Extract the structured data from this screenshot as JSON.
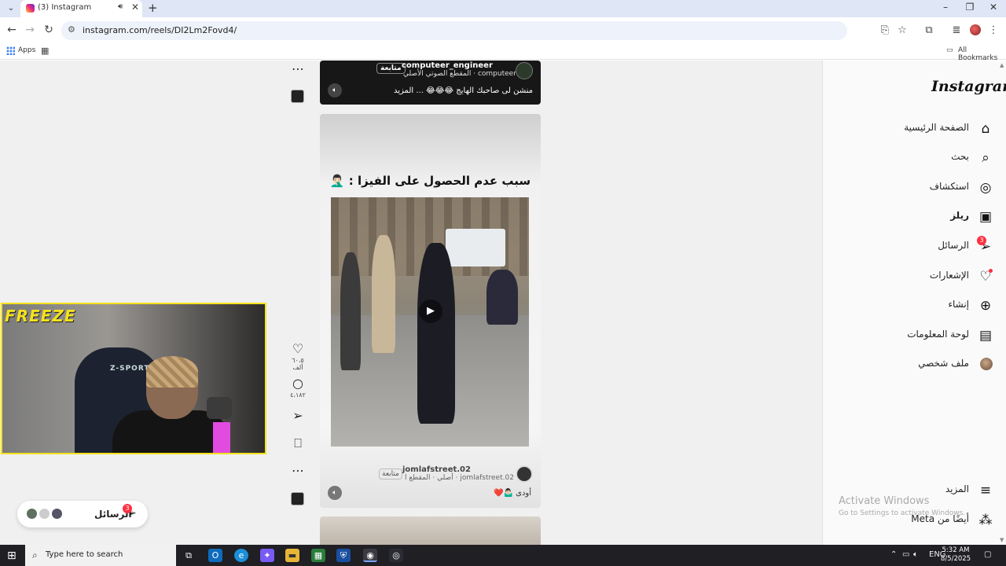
{
  "browser": {
    "tab_title": "(3) Instagram",
    "url": "instagram.com/reels/DI2Lm2Fovd4/",
    "bookmarks": {
      "apps_label": "Apps",
      "all_bookmarks_label": "All Bookmarks"
    }
  },
  "sidebar": {
    "logo": "Instagram",
    "items": [
      {
        "label": "الصفحة الرئيسية",
        "icon": "home-icon",
        "glyph": "⌂"
      },
      {
        "label": "بحث",
        "icon": "search-icon",
        "glyph": "⌕"
      },
      {
        "label": "استكشاف",
        "icon": "compass-icon",
        "glyph": "◎"
      },
      {
        "label": "ريلز",
        "icon": "reels-icon",
        "glyph": "▣",
        "active": true
      },
      {
        "label": "الرسائل",
        "icon": "messages-icon",
        "glyph": "➢",
        "badge": "3"
      },
      {
        "label": "الإشعارات",
        "icon": "heart-icon",
        "glyph": "♡"
      },
      {
        "label": "إنشاء",
        "icon": "create-icon",
        "glyph": "⊕"
      },
      {
        "label": "لوحة المعلومات",
        "icon": "dashboard-icon",
        "glyph": "▤"
      },
      {
        "label": "ملف شخصي",
        "icon": "avatar"
      },
      {
        "label": "المزيد",
        "icon": "menu-icon",
        "glyph": "≡"
      },
      {
        "label": "أيضًا من Meta",
        "icon": "meta-icon",
        "glyph": "⁂"
      }
    ]
  },
  "watermark": {
    "title": "Activate Windows",
    "subtitle": "Go to Settings to activate Windows."
  },
  "reel_top": {
    "author": "computeer_engineer",
    "follow_label": "متابعة",
    "audio": "computeer · المقطع الصوتي الأصلي",
    "caption": "منشن لى صاحبك الهايج 😂😂😂 ... المزيد"
  },
  "reel_main": {
    "headline": "سبب عدم الحصول على الفيزا : 🤦🏻‍♂️",
    "author": "jomlafstreet.02",
    "follow_label": "متابعة",
    "audio": "jomlafstreet.02 · أصلي · المقطع ا",
    "caption": "أودى 🤷🏻‍♂️❤️",
    "likes": "٦٠،٥ ألف",
    "comments": "٤،١٨٢"
  },
  "stream_overlay": {
    "brand": "FREEZE",
    "chair_text": "Z-SPORT"
  },
  "messages_pill": {
    "label": "الرسائل",
    "badge": "3"
  },
  "taskbar": {
    "search_placeholder": "Type here to search",
    "language": "ENG",
    "time": "5:32 AM",
    "date": "8/5/2025"
  }
}
